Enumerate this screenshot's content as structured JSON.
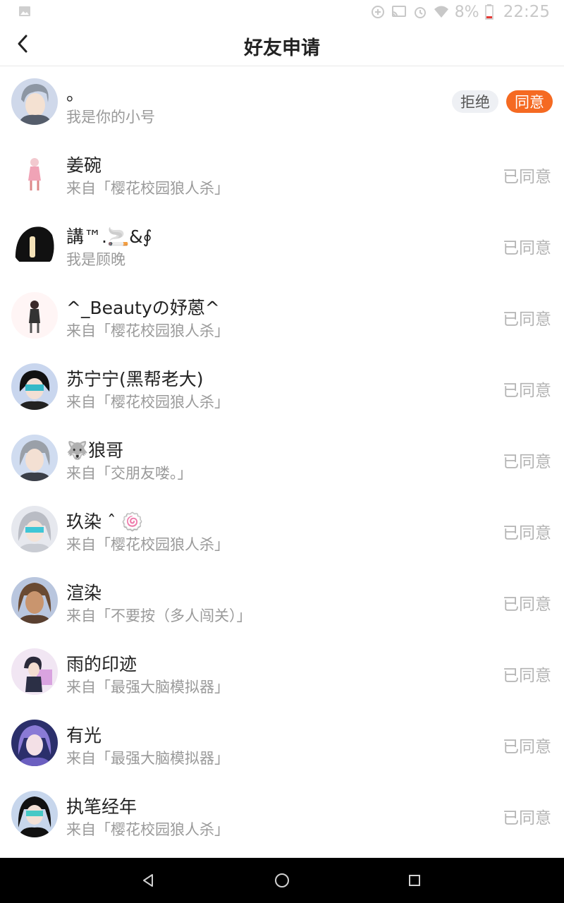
{
  "status_bar": {
    "battery": "8%",
    "time": "22:25",
    "icons": [
      "image-icon",
      "data-saver-icon",
      "cast-icon",
      "alarm-icon",
      "wifi-icon",
      "battery-icon"
    ]
  },
  "header": {
    "title": "好友申请",
    "back_icon": "back-arrow-icon"
  },
  "requests": [
    {
      "name": "。",
      "subtitle": "我是你的小号",
      "reject_label": "拒绝",
      "agree_label": "同意"
    },
    {
      "name": "姜碗",
      "subtitle": "来自「樱花校园狼人杀」",
      "status": "已同意"
    },
    {
      "name": "講™.🚬&∮",
      "subtitle": "我是顾晚",
      "status": "已同意"
    },
    {
      "name": "^_Beautyの妤蒽^",
      "subtitle": "来自「樱花校园狼人杀」",
      "status": "已同意"
    },
    {
      "name": "苏宁宁(黑帮老大)",
      "subtitle": "来自「樱花校园狼人杀」",
      "status": "已同意"
    },
    {
      "name": "🐺狼哥",
      "subtitle": "来自「交朋友喽。」",
      "status": "已同意"
    },
    {
      "name": "玖染 ˆ 🍥",
      "subtitle": "来自「樱花校园狼人杀」",
      "status": "已同意"
    },
    {
      "name": "渲染",
      "subtitle": "来自「不要按（多人闯关）」",
      "status": "已同意"
    },
    {
      "name": "雨的印迹",
      "subtitle": "来自「最强大脑模拟器」",
      "status": "已同意"
    },
    {
      "name": "有光",
      "subtitle": "来自「最强大脑模拟器」",
      "status": "已同意"
    },
    {
      "name": "执笔经年",
      "subtitle": "来自「樱花校园狼人杀」",
      "status": "已同意"
    }
  ],
  "nav": {
    "icons": [
      "nav-back-icon",
      "nav-home-icon",
      "nav-recents-icon"
    ]
  },
  "colors": {
    "accent": "#f56a22",
    "reject_bg": "#eef0f4",
    "muted_text": "#9a9a9a",
    "status_text": "#b4b4b4"
  }
}
